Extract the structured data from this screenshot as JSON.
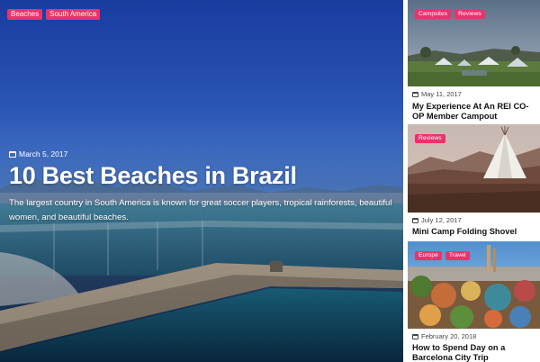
{
  "hero": {
    "tags": [
      "Beaches",
      "South America"
    ],
    "date": "March 5, 2017",
    "title": "10 Best Beaches in Brazil",
    "excerpt": "The largest country in South America is known for great soccer players, tropical rainforests, beautiful women, and beautiful beaches."
  },
  "cards": [
    {
      "tags": [
        "Campsites",
        "Reviews"
      ],
      "date": "May 11, 2017",
      "title": "My Experience At An REI CO-OP Member Campout"
    },
    {
      "tags": [
        "Reviews"
      ],
      "date": "July 12, 2017",
      "title": "Mini Camp Folding Shovel"
    },
    {
      "tags": [
        "Europe",
        "Travel"
      ],
      "date": "February 20, 2018",
      "title": "How to Spend Day on a Barcelona City Trip"
    }
  ],
  "colors": {
    "tag_bg": "#e8336d",
    "hero_sky": "#2b57b8",
    "text_dark": "#111111"
  },
  "icons": {
    "date": "calendar-icon"
  }
}
